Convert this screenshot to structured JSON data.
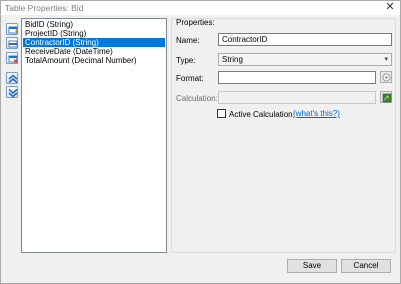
{
  "window": {
    "title": "Table Properties: Bid",
    "close_glyph": "✕"
  },
  "side_buttons": [
    {
      "name": "add-field-icon"
    },
    {
      "name": "insert-field-icon"
    },
    {
      "name": "delete-field-icon"
    },
    {
      "name": "move-up-icon"
    },
    {
      "name": "move-down-icon"
    }
  ],
  "fields": [
    {
      "label": "BidID (String)",
      "selected": false
    },
    {
      "label": "ProjectID (String)",
      "selected": false
    },
    {
      "label": "ContractorID (String)",
      "selected": true
    },
    {
      "label": "ReceiveDate (DateTime)",
      "selected": false
    },
    {
      "label": "TotalAmount (Decimal Number)",
      "selected": false
    }
  ],
  "properties": {
    "heading": "Properties:",
    "name_label": "Name:",
    "name_value": "ContractorID",
    "type_label": "Type:",
    "type_value": "String",
    "format_label": "Format:",
    "format_value": "",
    "calculation_label": "Calculation:",
    "calculation_value": "",
    "active_calc_label": "Active Calculation",
    "active_calc_checked": false,
    "whats_this": "(what's this?)"
  },
  "buttons": {
    "save": "Save",
    "cancel": "Cancel"
  },
  "colors": {
    "selection": "#0078d7",
    "link": "#0066cc",
    "accent_icon": "#2a6cc4"
  }
}
